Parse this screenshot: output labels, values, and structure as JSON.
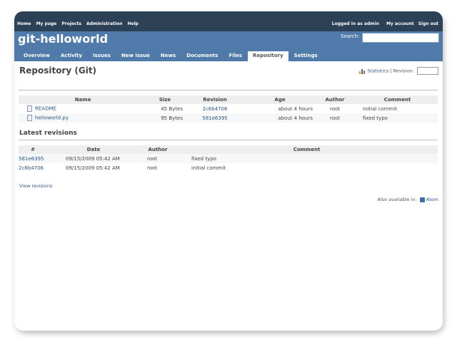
{
  "topmenu": {
    "left": [
      "Home",
      "My page",
      "Projects",
      "Administration",
      "Help"
    ],
    "logged_in": "Logged in as admin",
    "my_account": "My account",
    "sign_out": "Sign out"
  },
  "header": {
    "title": "git-helloworld",
    "search_label": "Search:",
    "search_value": ""
  },
  "tabs": [
    "Overview",
    "Activity",
    "Issues",
    "New issue",
    "News",
    "Documents",
    "Files",
    "Repository",
    "Settings"
  ],
  "selected_tab": "Repository",
  "page": {
    "title": "Repository (Git)",
    "statistics": "Statistics",
    "revision_label": "| Revision:"
  },
  "browser": {
    "headers": [
      "Name",
      "Size",
      "Revision",
      "Age",
      "Author",
      "Comment"
    ],
    "rows": [
      {
        "name": "README",
        "size": "45 Bytes",
        "revision": "2c6b4706",
        "age": "about 4 hours",
        "author": "root",
        "comment": "initial commit"
      },
      {
        "name": "helloworld.py",
        "size": "95 Bytes",
        "revision": "581e6395",
        "age": "about 4 hours",
        "author": "root",
        "comment": "fixed typo"
      }
    ]
  },
  "latest": {
    "title": "Latest revisions",
    "headers": [
      "#",
      "Date",
      "Author",
      "Comment"
    ],
    "rows": [
      {
        "rev": "581e6395",
        "date": "09/15/2009 05:42 AM",
        "author": "root",
        "comment": "fixed typo"
      },
      {
        "rev": "2c6b4706",
        "date": "09/15/2009 05:42 AM",
        "author": "root",
        "comment": "initial commit"
      }
    ],
    "view_revisions": "View revisions"
  },
  "footer": {
    "also_available": "Also available in:",
    "atom": "Atom"
  },
  "colors": {
    "topmenu_bg": "#2C4056",
    "header_bg": "#507AAA",
    "link": "#2A5685"
  }
}
